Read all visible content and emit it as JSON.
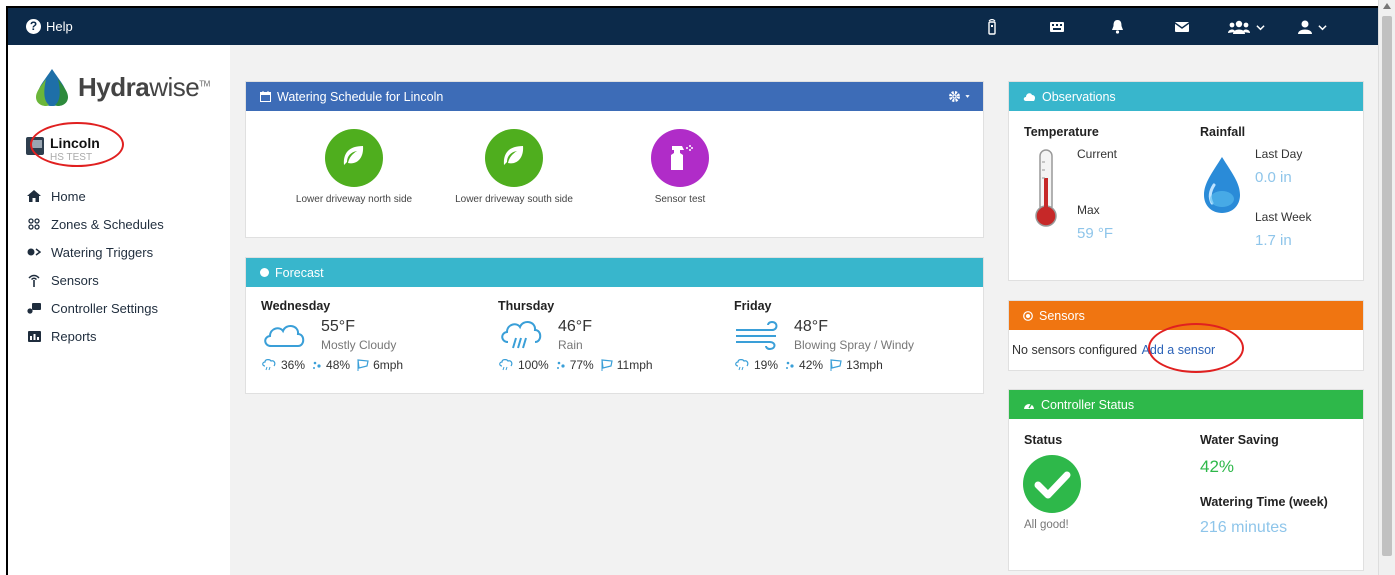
{
  "topbar": {
    "help_label": "Help",
    "icons": [
      "remote-icon",
      "keyboard-icon",
      "bell-icon",
      "envelope-icon",
      "users-icon",
      "user-icon"
    ]
  },
  "sidebar": {
    "logo_text_bold": "Hydra",
    "logo_text_light": "wise",
    "logo_tm": "TM",
    "controller_name": "Lincoln",
    "controller_sub": "HS TEST",
    "nav": [
      {
        "label": "Home",
        "icon": "home-icon"
      },
      {
        "label": "Zones & Schedules",
        "icon": "zones-icon"
      },
      {
        "label": "Watering Triggers",
        "icon": "toggle-icon"
      },
      {
        "label": "Sensors",
        "icon": "antenna-icon"
      },
      {
        "label": "Controller Settings",
        "icon": "settings-icon"
      },
      {
        "label": "Reports",
        "icon": "reports-icon"
      }
    ]
  },
  "schedule": {
    "title": "Watering Schedule for Lincoln",
    "zones": [
      {
        "label": "Lower driveway north side",
        "color": "#4fae1e",
        "icon": "leaf-icon"
      },
      {
        "label": "Lower driveway south side",
        "color": "#4fae1e",
        "icon": "leaf-icon"
      },
      {
        "label": "Sensor test",
        "color": "#b02cc8",
        "icon": "spray-bottle-icon"
      }
    ]
  },
  "forecast": {
    "title": "Forecast",
    "days": [
      {
        "day": "Wednesday",
        "temp": "55°F",
        "condition": "Mostly Cloudy",
        "rain": "36%",
        "humidity": "48%",
        "wind": "6mph",
        "icon": "cloud-icon"
      },
      {
        "day": "Thursday",
        "temp": "46°F",
        "condition": "Rain",
        "rain": "100%",
        "humidity": "77%",
        "wind": "11mph",
        "icon": "rain-cloud-icon"
      },
      {
        "day": "Friday",
        "temp": "48°F",
        "condition": "Blowing Spray / Windy",
        "rain": "19%",
        "humidity": "42%",
        "wind": "13mph",
        "icon": "wind-icon"
      }
    ]
  },
  "observations": {
    "title": "Observations",
    "temperature_label": "Temperature",
    "current_label": "Current",
    "max_label": "Max",
    "max_value": "59 °F",
    "rainfall_label": "Rainfall",
    "last_day_label": "Last Day",
    "last_day_value": "0.0 in",
    "last_week_label": "Last Week",
    "last_week_value": "1.7 in"
  },
  "sensors": {
    "title": "Sensors",
    "message": "No sensors configured",
    "link": "Add a sensor"
  },
  "status": {
    "title": "Controller Status",
    "status_label": "Status",
    "status_text": "All good!",
    "water_saving_label": "Water Saving",
    "water_saving_value": "42%",
    "watering_time_label": "Watering Time (week)",
    "watering_time_value": "216 minutes"
  },
  "colors": {
    "topbar": "#0c2a4a",
    "schedule_header": "#3d6cb7",
    "teal_header": "#38b6cc",
    "sensors_header": "#f07511",
    "status_header": "#2eb84a",
    "annotation": "#e02020"
  }
}
